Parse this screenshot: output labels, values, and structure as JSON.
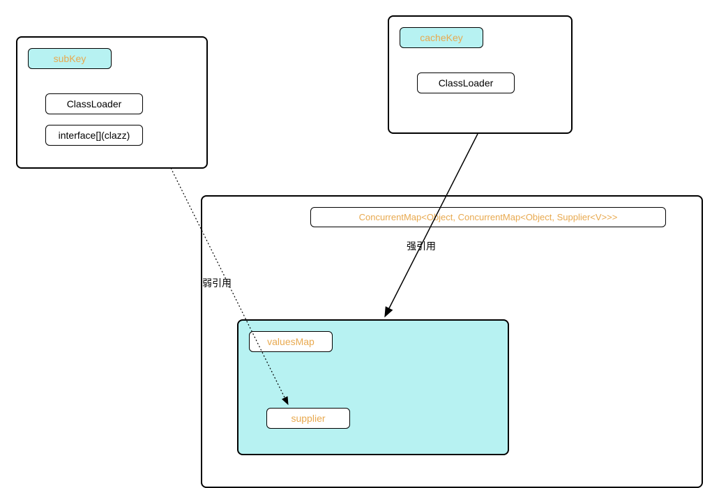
{
  "boxes": {
    "subkey": {
      "title": "subKey",
      "items": [
        "ClassLoader",
        "interface[](clazz)"
      ]
    },
    "cachekey": {
      "title": "cacheKey",
      "items": [
        "ClassLoader"
      ]
    },
    "concurrentMap": {
      "title": "ConcurrentMap<Object, ConcurrentMap<Object, Supplier<V>>>"
    },
    "valuesMap": {
      "title": "valuesMap",
      "inner": "supplier"
    }
  },
  "labels": {
    "weakRef": "弱引用",
    "strongRef": "强引用"
  }
}
